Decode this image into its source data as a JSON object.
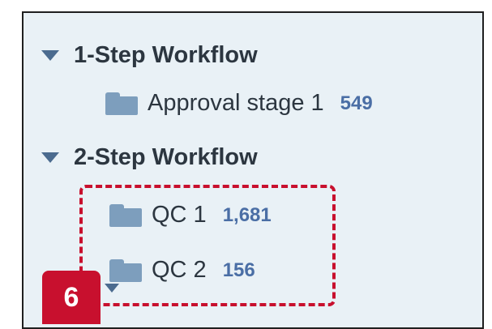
{
  "tree": {
    "groups": [
      {
        "label": "1-Step Workflow",
        "items": [
          {
            "label": "Approval stage 1",
            "count": "549"
          }
        ]
      },
      {
        "label": "2-Step Workflow",
        "items": [
          {
            "label": "QC 1",
            "count": "1,681"
          },
          {
            "label": "QC 2",
            "count": "156"
          }
        ]
      }
    ]
  },
  "annotation": {
    "step_number": "6",
    "color": "#c8102e"
  },
  "colors": {
    "panel_background": "#e9f1f6",
    "folder": "#7d9ebd",
    "count_text": "#4a6ea5",
    "caret": "#4b6b8f"
  },
  "icons": {
    "group_toggle": "caret-down-icon",
    "folder": "folder-icon"
  }
}
